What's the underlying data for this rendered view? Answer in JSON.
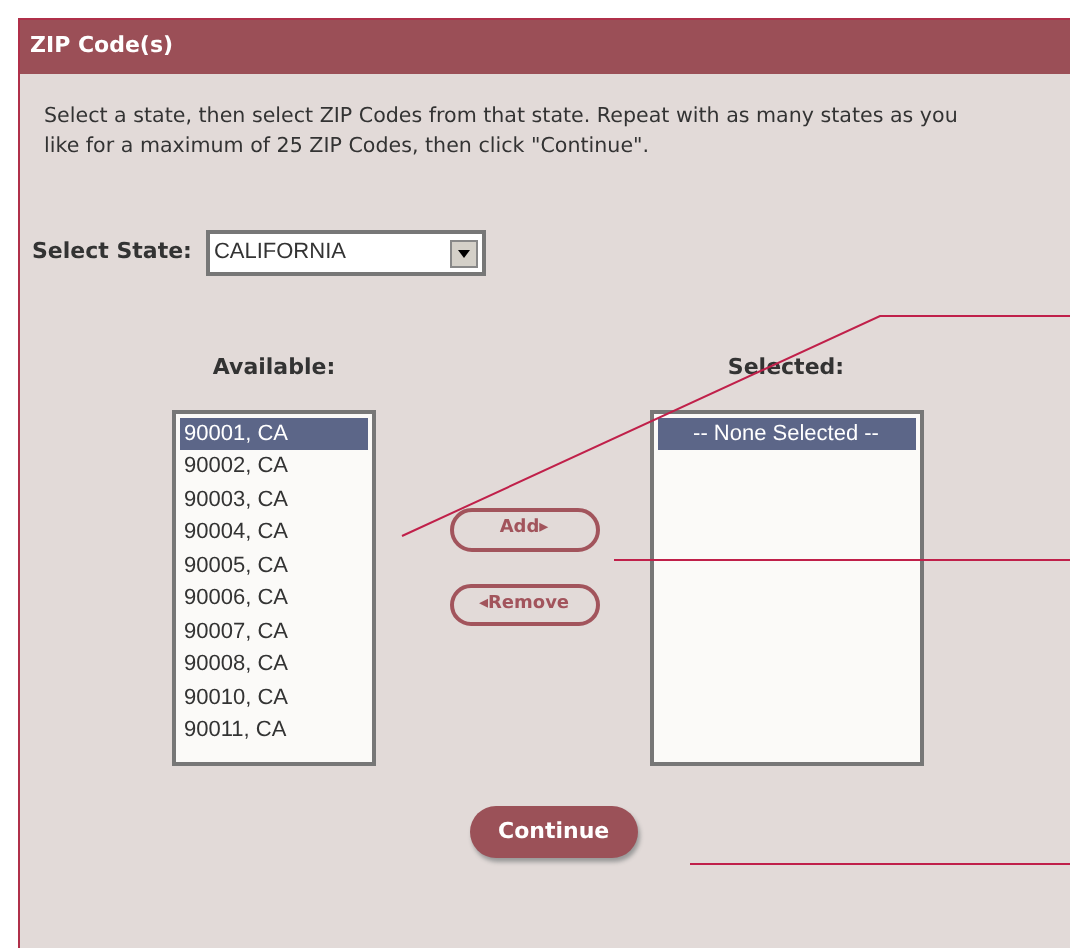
{
  "panel": {
    "title": "ZIP Code(s)",
    "instructions": "Select a state, then select ZIP Codes from that state. Repeat with as many states as you like for a maximum of 25 ZIP Codes, then click \"Continue\"."
  },
  "state_select": {
    "label": "Select State:",
    "value": "CALIFORNIA"
  },
  "available": {
    "label": "Available:",
    "items": [
      {
        "text": "90001, CA",
        "selected": true
      },
      {
        "text": "90002, CA",
        "selected": false
      },
      {
        "text": "90003, CA",
        "selected": false
      },
      {
        "text": "90004, CA",
        "selected": false
      },
      {
        "text": "90005, CA",
        "selected": false
      },
      {
        "text": "90006, CA",
        "selected": false
      },
      {
        "text": "90007, CA",
        "selected": false
      },
      {
        "text": "90008, CA",
        "selected": false
      },
      {
        "text": "90010, CA",
        "selected": false
      },
      {
        "text": "90011, CA",
        "selected": false
      }
    ]
  },
  "buttons": {
    "add": "Add▸",
    "remove": "◂Remove",
    "continue": "Continue"
  },
  "selected": {
    "label": "Selected:",
    "items": [
      {
        "text": "-- None Selected --",
        "selected": true
      }
    ]
  }
}
